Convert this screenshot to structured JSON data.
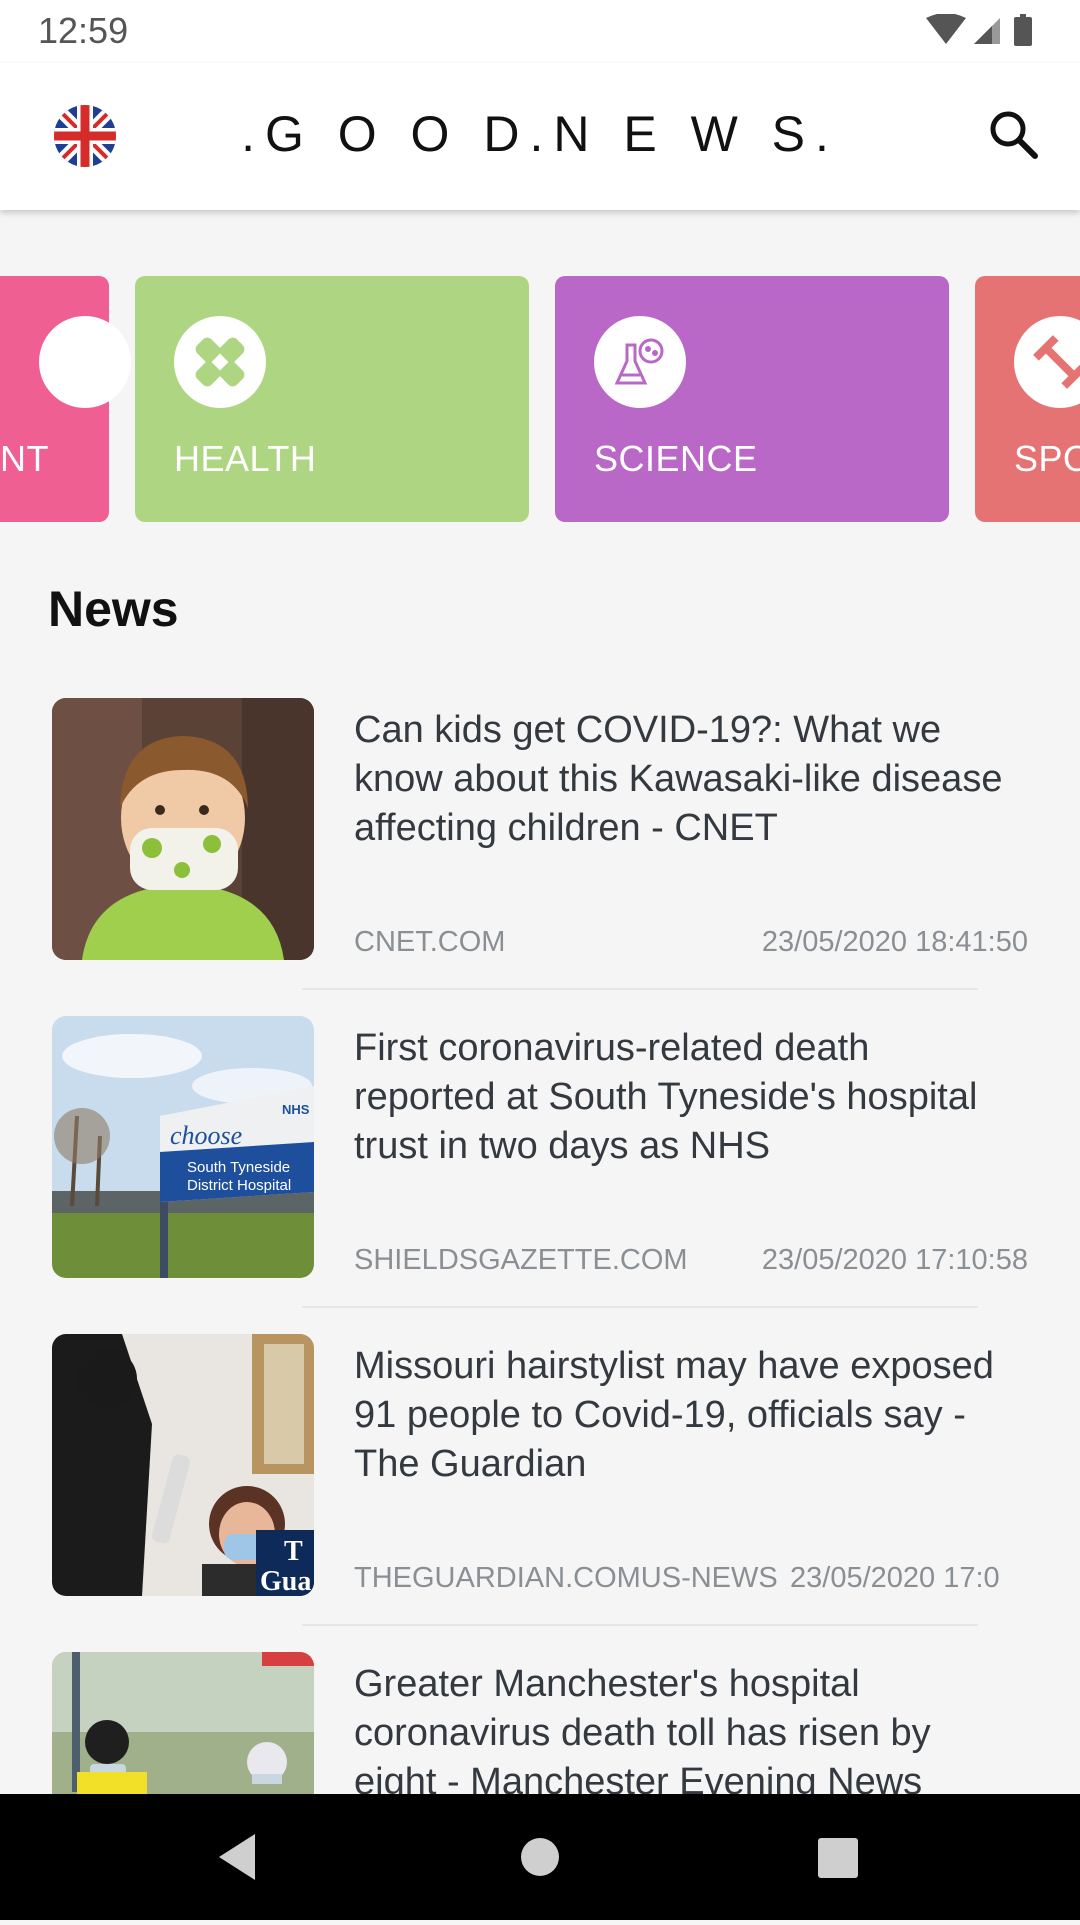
{
  "status_bar": {
    "time": "12:59",
    "icons": [
      "wifi-icon",
      "signal-icon",
      "battery-icon"
    ]
  },
  "app_bar": {
    "title": ".G O O D.N E W S.",
    "language_icon": "uk-flag-icon",
    "search_icon": "search-icon"
  },
  "categories": [
    {
      "label": "NT",
      "color": "#ef5f91",
      "icon": "entertainment-icon"
    },
    {
      "label": "HEALTH",
      "color": "#aed581",
      "icon": "bandage-icon"
    },
    {
      "label": "SCIENCE",
      "color": "#ba68c8",
      "icon": "flask-icon"
    },
    {
      "label": "SPO",
      "color": "#e57373",
      "icon": "dumbbell-icon"
    }
  ],
  "news_section": {
    "title": "News",
    "items": [
      {
        "title": "Can kids get COVID-19?: What we know about this Kawasaki-like disease affecting children - CNET",
        "source": "CNET.COM",
        "date": "23/05/2020 18:41:50"
      },
      {
        "title": "First coronavirus-related death reported at South Tyneside's hospital trust in two days as NHS",
        "source": "SHIELDSGAZETTE.COM",
        "date": "23/05/2020 17:10:58",
        "image_text": [
          "choose",
          "South Tyneside",
          "District Hospital",
          "NHS"
        ]
      },
      {
        "title": "Missouri hairstylist may have exposed 91 people to Covid-19, officials say - The Guardian",
        "source": "THEGUARDIAN.COMUS-NEWS",
        "date": "23/05/2020 17:0",
        "image_text": [
          "T",
          "Gua"
        ]
      },
      {
        "title": "Greater Manchester's hospital coronavirus death toll has risen by eight - Manchester Evening News",
        "source": "",
        "date": ""
      }
    ]
  },
  "nav_bar": {
    "buttons": [
      "back-button",
      "home-button",
      "recents-button"
    ]
  }
}
